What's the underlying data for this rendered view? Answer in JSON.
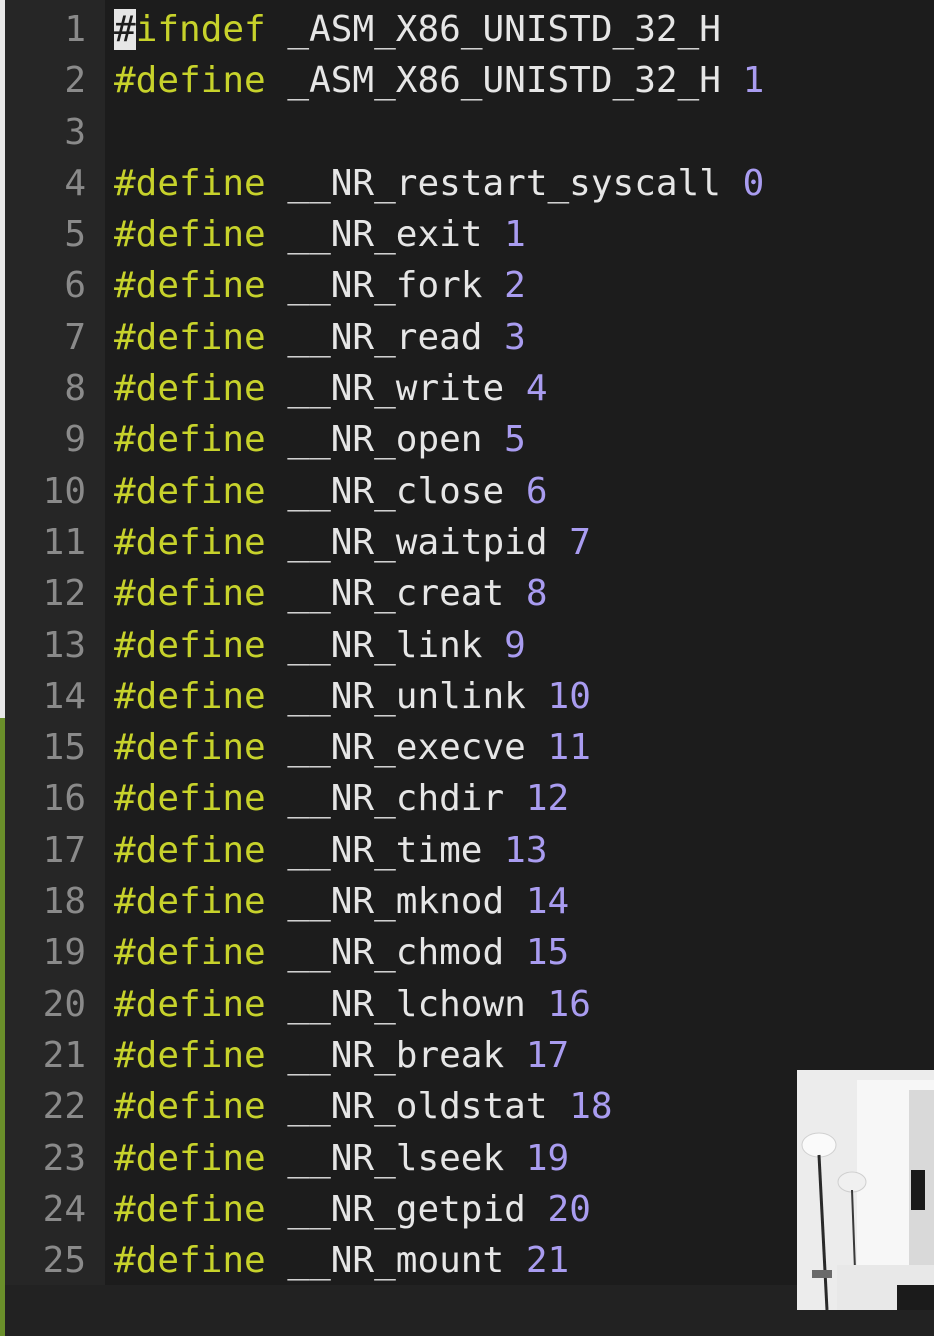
{
  "editor": {
    "lines": [
      {
        "n": "1",
        "cursor": "#",
        "pre": "ifndef",
        "name": "_ASM_X86_UNISTD_32_H",
        "value": ""
      },
      {
        "n": "2",
        "pre": "#define",
        "name": "_ASM_X86_UNISTD_32_H",
        "value": "1"
      },
      {
        "n": "3",
        "pre": "",
        "name": "",
        "value": ""
      },
      {
        "n": "4",
        "pre": "#define",
        "name": "__NR_restart_syscall",
        "value": "0"
      },
      {
        "n": "5",
        "pre": "#define",
        "name": "__NR_exit",
        "value": "1"
      },
      {
        "n": "6",
        "pre": "#define",
        "name": "__NR_fork",
        "value": "2"
      },
      {
        "n": "7",
        "pre": "#define",
        "name": "__NR_read",
        "value": "3"
      },
      {
        "n": "8",
        "pre": "#define",
        "name": "__NR_write",
        "value": "4"
      },
      {
        "n": "9",
        "pre": "#define",
        "name": "__NR_open",
        "value": "5"
      },
      {
        "n": "10",
        "pre": "#define",
        "name": "__NR_close",
        "value": "6"
      },
      {
        "n": "11",
        "pre": "#define",
        "name": "__NR_waitpid",
        "value": "7"
      },
      {
        "n": "12",
        "pre": "#define",
        "name": "__NR_creat",
        "value": "8"
      },
      {
        "n": "13",
        "pre": "#define",
        "name": "__NR_link",
        "value": "9"
      },
      {
        "n": "14",
        "pre": "#define",
        "name": "__NR_unlink",
        "value": "10"
      },
      {
        "n": "15",
        "pre": "#define",
        "name": "__NR_execve",
        "value": "11"
      },
      {
        "n": "16",
        "pre": "#define",
        "name": "__NR_chdir",
        "value": "12"
      },
      {
        "n": "17",
        "pre": "#define",
        "name": "__NR_time",
        "value": "13"
      },
      {
        "n": "18",
        "pre": "#define",
        "name": "__NR_mknod",
        "value": "14"
      },
      {
        "n": "19",
        "pre": "#define",
        "name": "__NR_chmod",
        "value": "15"
      },
      {
        "n": "20",
        "pre": "#define",
        "name": "__NR_lchown",
        "value": "16"
      },
      {
        "n": "21",
        "pre": "#define",
        "name": "__NR_break",
        "value": "17"
      },
      {
        "n": "22",
        "pre": "#define",
        "name": "__NR_oldstat",
        "value": "18"
      },
      {
        "n": "23",
        "pre": "#define",
        "name": "__NR_lseek",
        "value": "19"
      },
      {
        "n": "24",
        "pre": "#define",
        "name": "__NR_getpid",
        "value": "20"
      },
      {
        "n": "25",
        "pre": "#define",
        "name": "__NR_mount",
        "value": "21"
      }
    ]
  },
  "colors": {
    "keyword": "#c7d22b",
    "number": "#a99cf0",
    "text": "#e6e6e6",
    "line_number": "#8a8a8a",
    "background": "#1c1c1c"
  }
}
